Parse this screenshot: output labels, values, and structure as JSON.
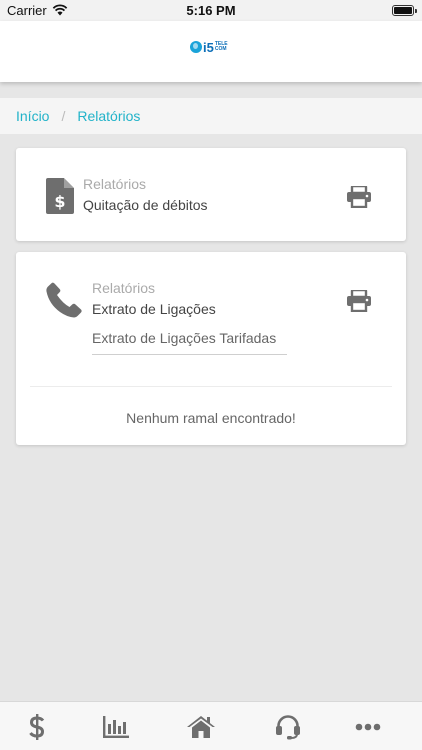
{
  "status_bar": {
    "carrier": "Carrier",
    "time": "5:16 PM"
  },
  "header": {
    "logo_number": "i5",
    "logo_tele": "TELE",
    "logo_com": "COM"
  },
  "breadcrumb": {
    "home": "Início",
    "separator": "/",
    "current": "Relatórios"
  },
  "card_debts": {
    "icon": "invoice-dollar-icon",
    "caption": "Relatórios",
    "title": "Quitação de débitos",
    "print_icon": "printer-icon"
  },
  "card_calls": {
    "icon": "phone-icon",
    "caption": "Relatórios",
    "title": "Extrato de Ligações",
    "select_value": "Extrato de Ligações Tarifadas",
    "empty_message": "Nenhum ramal encontrado!",
    "print_icon": "printer-icon"
  },
  "tab_bar": {
    "tabs": [
      "dollar-icon",
      "chart-icon",
      "home-icon",
      "headset-icon",
      "more-icon"
    ]
  },
  "colors": {
    "accent": "#22b3c9",
    "icon_gray": "#6e6e6e",
    "background": "#e6e6e6"
  }
}
